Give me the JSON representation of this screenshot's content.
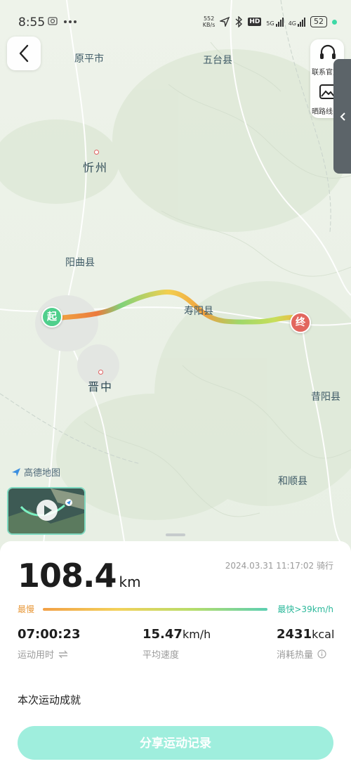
{
  "status_bar": {
    "time": "8:55",
    "net_speed_value": "552",
    "net_speed_unit": "KB/s",
    "signal_5g": "5G",
    "signal_4g": "4G",
    "battery": "52",
    "hd_label": "HD"
  },
  "map": {
    "places": {
      "yuanping": "原平市",
      "wutai": "五台县",
      "xinzhou": "忻州",
      "yangqu": "阳曲县",
      "shouyang": "寿阳县",
      "jinzhong": "晋中",
      "xiyang": "昔阳县",
      "heshun": "和顺县"
    },
    "start_marker": "起",
    "end_marker": "终",
    "attribution": "高德地图"
  },
  "side_panel": {
    "contact_label": "联系官方",
    "share_route_label": "晒路线"
  },
  "summary": {
    "distance_value": "108.4",
    "distance_unit": "km",
    "datetime_type": "2024.03.31 11:17:02 骑行",
    "speed_legend": {
      "slow": "最慢",
      "fast": "最快>39km/h"
    },
    "stats": [
      {
        "value": "07:00:23",
        "unit": "",
        "label": "运动用时"
      },
      {
        "value": "15.47",
        "unit": "km/h",
        "label": "平均速度"
      },
      {
        "value": "2431",
        "unit": "kcal",
        "label": "消耗热量"
      }
    ],
    "achievements_title": "本次运动成就",
    "share_button": "分享运动记录"
  },
  "colors": {
    "accent": "#9feedd",
    "start": "#4fcf8c",
    "end": "#e2665e"
  }
}
